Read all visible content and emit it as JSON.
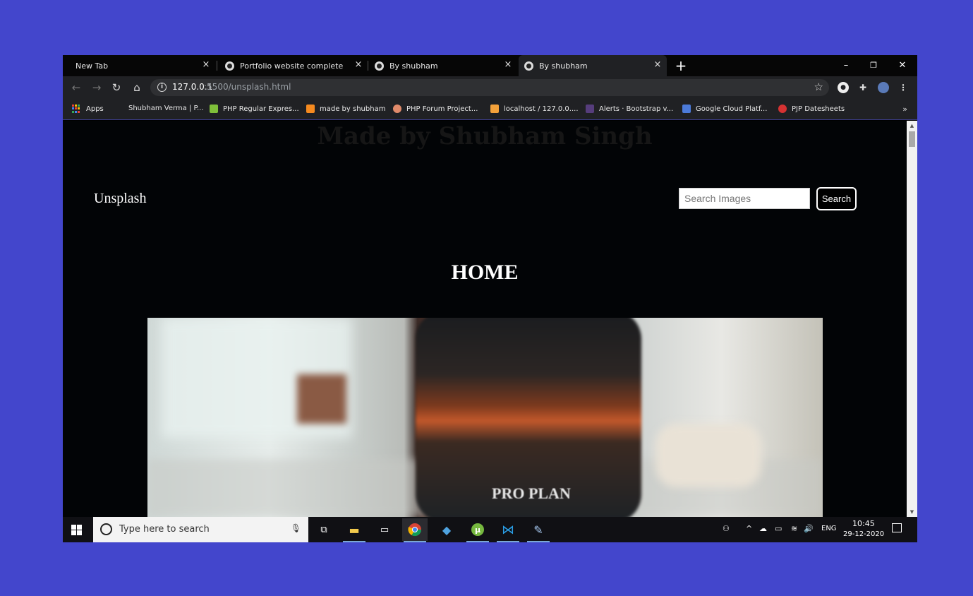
{
  "browser": {
    "tabs": [
      {
        "title": "New Tab"
      },
      {
        "title": "Portfolio website complete"
      },
      {
        "title": "By shubham"
      },
      {
        "title": "By shubham",
        "active": true
      }
    ],
    "close_glyph": "×",
    "new_tab_glyph": "+",
    "window_controls": {
      "minimize": "–",
      "restore": "❐",
      "close": "✕"
    },
    "url": {
      "host": "127.0.0.1",
      "path": ":5500/unsplash.html"
    },
    "nav_icons": [
      "back-icon",
      "forward-icon",
      "reload-icon",
      "home-icon"
    ],
    "bookmarks": [
      {
        "label": "Apps",
        "icon": "apps-grid-icon"
      },
      {
        "label": "Shubham Verma | P...",
        "icon": "linkedin-icon"
      },
      {
        "label": "PHP Regular Expres...",
        "icon": "php-icon",
        "color": "#7fbf3a"
      },
      {
        "label": "made by shubham",
        "icon": "xampp-icon",
        "color": "#f58a1f"
      },
      {
        "label": "PHP Forum Project...",
        "icon": "avatar-icon",
        "color": "#e08a6a"
      },
      {
        "label": "localhost / 127.0.0....",
        "icon": "phpmyadmin-icon",
        "color": "#f3a13a"
      },
      {
        "label": "Alerts · Bootstrap v...",
        "icon": "bootstrap-icon",
        "color": "#563d7c"
      },
      {
        "label": "Google Cloud Platf...",
        "icon": "gcp-icon",
        "color": "#4c7bd9"
      },
      {
        "label": "PJP Datesheets",
        "icon": "pjp-icon",
        "color": "#d63232"
      }
    ],
    "more_bookmarks": "»"
  },
  "page": {
    "watermark": "Made by Shubham Singh",
    "brand": "Unsplash",
    "search": {
      "placeholder": "Search Images",
      "value": "",
      "button_label": "Search"
    },
    "heading": "HOME",
    "photo": {
      "bag_text": "PRO PLAN"
    }
  },
  "taskbar": {
    "search_placeholder": "Type here to search",
    "apps": [
      "task-view-icon",
      "file-explorer-icon",
      "terminal-icon",
      "chrome-icon",
      "azure-data-studio-icon",
      "utorrent-icon",
      "vscode-icon",
      "paint-icon"
    ],
    "language": "ENG",
    "time": "10:45",
    "date": "29-12-2020"
  },
  "colors": {
    "desktop_bg": "#4346cc",
    "page_bg": "#020406",
    "tab_bg": "#202124"
  }
}
